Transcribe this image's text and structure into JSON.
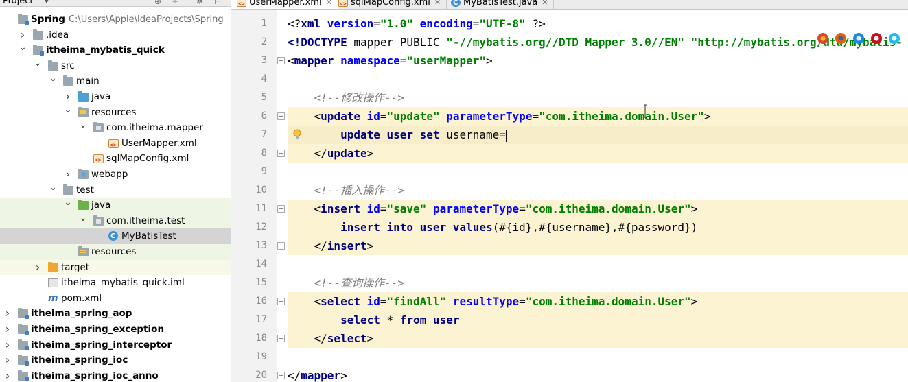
{
  "project_panel": {
    "title": "Project",
    "tree": [
      {
        "label": "Spring",
        "path": "C:\\Users\\Apple\\IdeaProjects\\Spring",
        "bold": true,
        "level": 0,
        "arrow": "none",
        "icon": "module-folder-icon"
      },
      {
        "label": ".idea",
        "level": 1,
        "arrow": "collapsed",
        "icon": "folder-icon"
      },
      {
        "label": "itheima_mybatis_quick",
        "bold": true,
        "level": 1,
        "arrow": "expanded",
        "icon": "module-folder-icon"
      },
      {
        "label": "src",
        "level": 2,
        "arrow": "expanded",
        "icon": "folder-icon"
      },
      {
        "label": "main",
        "level": 3,
        "arrow": "expanded",
        "icon": "folder-icon"
      },
      {
        "label": "java",
        "level": 4,
        "arrow": "collapsed",
        "icon": "source-folder-icon"
      },
      {
        "label": "resources",
        "level": 4,
        "arrow": "expanded",
        "icon": "resources-folder-icon"
      },
      {
        "label": "com.itheima.mapper",
        "level": 5,
        "arrow": "expanded",
        "icon": "package-icon"
      },
      {
        "label": "UserMapper.xml",
        "level": 6,
        "arrow": "none",
        "icon": "xml-file-icon"
      },
      {
        "label": "sqlMapConfig.xml",
        "level": 5,
        "arrow": "none",
        "icon": "xml-file-icon"
      },
      {
        "label": "webapp",
        "level": 4,
        "arrow": "collapsed",
        "icon": "web-folder-icon"
      },
      {
        "label": "test",
        "level": 3,
        "arrow": "expanded",
        "icon": "folder-icon"
      },
      {
        "label": "java",
        "level": 4,
        "arrow": "expanded",
        "icon": "test-folder-icon",
        "highlight": "green"
      },
      {
        "label": "com.itheima.test",
        "level": 5,
        "arrow": "expanded",
        "icon": "package-icon",
        "highlight": "green"
      },
      {
        "label": "MyBatisTest",
        "level": 6,
        "arrow": "none",
        "icon": "class-icon",
        "highlight": "selected"
      },
      {
        "label": "resources",
        "level": 4,
        "arrow": "none",
        "icon": "test-resources-folder-icon",
        "highlight": "green"
      },
      {
        "label": "target",
        "level": 2,
        "arrow": "collapsed",
        "icon": "excluded-folder-icon",
        "highlight": "yellow"
      },
      {
        "label": "itheima_mybatis_quick.iml",
        "level": 2,
        "arrow": "none",
        "icon": "iml-file-icon"
      },
      {
        "label": "pom.xml",
        "level": 2,
        "arrow": "none",
        "icon": "maven-icon"
      },
      {
        "label": "itheima_spring_aop",
        "bold": true,
        "level": 0,
        "arrow": "collapsed",
        "icon": "module-folder-icon"
      },
      {
        "label": "itheima_spring_exception",
        "bold": true,
        "level": 0,
        "arrow": "collapsed",
        "icon": "module-folder-icon"
      },
      {
        "label": "itheima_spring_interceptor",
        "bold": true,
        "level": 0,
        "arrow": "collapsed",
        "icon": "module-folder-icon"
      },
      {
        "label": "itheima_spring_ioc",
        "bold": true,
        "level": 0,
        "arrow": "collapsed",
        "icon": "module-folder-icon"
      },
      {
        "label": "itheima_spring_ioc_anno",
        "bold": true,
        "level": 0,
        "arrow": "collapsed",
        "icon": "module-folder-icon"
      }
    ]
  },
  "tabs": [
    {
      "label": "UserMapper.xml",
      "active": true,
      "icon": "xml-file-icon"
    },
    {
      "label": "sqlMapConfig.xml",
      "active": false,
      "icon": "xml-file-icon"
    },
    {
      "label": "MyBatisTest.java",
      "active": false,
      "icon": "class-icon"
    }
  ],
  "editor": {
    "lines": [
      {
        "n": "1",
        "tokens": [
          [
            "p",
            "<?"
          ],
          [
            "k",
            "xml "
          ],
          [
            "a",
            "version"
          ],
          [
            "p",
            "="
          ],
          [
            "s",
            "\"1.0\" "
          ],
          [
            "a",
            "encoding"
          ],
          [
            "p",
            "="
          ],
          [
            "s",
            "\"UTF-8\""
          ],
          [
            "p",
            " ?>"
          ]
        ]
      },
      {
        "n": "2",
        "tokens": [
          [
            "k",
            "<!DOCTYPE "
          ],
          [
            "p",
            "mapper PUBLIC "
          ],
          [
            "s",
            "\"-//mybatis.org//DTD Mapper 3.0//EN\" \"http://mybatis.org/dtd/mybatis-"
          ]
        ]
      },
      {
        "n": "3",
        "fold": true,
        "tokens": [
          [
            "p",
            "<"
          ],
          [
            "k",
            "mapper "
          ],
          [
            "a",
            "namespace"
          ],
          [
            "p",
            "="
          ],
          [
            "s",
            "\"userMapper\""
          ],
          [
            "p",
            ">"
          ]
        ]
      },
      {
        "n": "4",
        "tokens": []
      },
      {
        "n": "5",
        "tokens": [
          [
            "c",
            "    <!--修改操作-->"
          ]
        ]
      },
      {
        "n": "6",
        "fold": true,
        "hl": true,
        "tokens": [
          [
            "p",
            "    <"
          ],
          [
            "k",
            "update "
          ],
          [
            "a",
            "id"
          ],
          [
            "p",
            "="
          ],
          [
            "s",
            "\"update\" "
          ],
          [
            "a",
            "parameterType"
          ],
          [
            "p",
            "="
          ],
          [
            "s",
            "\"com.itheima.domain.User\""
          ],
          [
            "p",
            ">"
          ]
        ]
      },
      {
        "n": "7",
        "hl": true,
        "current": true,
        "bulb": true,
        "tokens": [
          [
            "k",
            "        update user set "
          ],
          [
            "t",
            "username="
          ]
        ],
        "caret": true
      },
      {
        "n": "8",
        "fold": true,
        "hl": true,
        "tokens": [
          [
            "p",
            "    </"
          ],
          [
            "k",
            "update"
          ],
          [
            "p",
            ">"
          ]
        ]
      },
      {
        "n": "9",
        "tokens": []
      },
      {
        "n": "10",
        "tokens": [
          [
            "c",
            "    <!--插入操作-->"
          ]
        ]
      },
      {
        "n": "11",
        "fold": true,
        "hl": true,
        "tokens": [
          [
            "p",
            "    <"
          ],
          [
            "k",
            "insert "
          ],
          [
            "a",
            "id"
          ],
          [
            "p",
            "="
          ],
          [
            "s",
            "\"save\" "
          ],
          [
            "a",
            "parameterType"
          ],
          [
            "p",
            "="
          ],
          [
            "s",
            "\"com.itheima.domain.User\""
          ],
          [
            "p",
            ">"
          ]
        ]
      },
      {
        "n": "12",
        "hl": true,
        "tokens": [
          [
            "k",
            "        insert into user values"
          ],
          [
            "t",
            "(#{id},#{username},#{password})"
          ]
        ]
      },
      {
        "n": "13",
        "fold": true,
        "hl": true,
        "tokens": [
          [
            "p",
            "    </"
          ],
          [
            "k",
            "insert"
          ],
          [
            "p",
            ">"
          ]
        ]
      },
      {
        "n": "14",
        "tokens": []
      },
      {
        "n": "15",
        "tokens": [
          [
            "c",
            "    <!--查询操作-->"
          ]
        ]
      },
      {
        "n": "16",
        "fold": true,
        "hl": true,
        "tokens": [
          [
            "p",
            "    <"
          ],
          [
            "k",
            "select "
          ],
          [
            "a",
            "id"
          ],
          [
            "p",
            "="
          ],
          [
            "s",
            "\"findAll\" "
          ],
          [
            "a",
            "resultType"
          ],
          [
            "p",
            "="
          ],
          [
            "s",
            "\"com.itheima.domain.User\""
          ],
          [
            "p",
            ">"
          ]
        ]
      },
      {
        "n": "17",
        "hl": true,
        "tokens": [
          [
            "k",
            "        select "
          ],
          [
            "t",
            "* "
          ],
          [
            "k",
            "from user"
          ]
        ]
      },
      {
        "n": "18",
        "fold": true,
        "hl": true,
        "tokens": [
          [
            "p",
            "    </"
          ],
          [
            "k",
            "select"
          ],
          [
            "p",
            ">"
          ]
        ]
      },
      {
        "n": "19",
        "tokens": []
      },
      {
        "n": "20",
        "fold": true,
        "tokens": [
          [
            "p",
            "</"
          ],
          [
            "k",
            "mapper"
          ],
          [
            "p",
            ">"
          ]
        ]
      }
    ]
  },
  "browser_icons": [
    "chrome-icon",
    "firefox-icon",
    "safari-icon",
    "opera-icon",
    "ie-icon"
  ]
}
